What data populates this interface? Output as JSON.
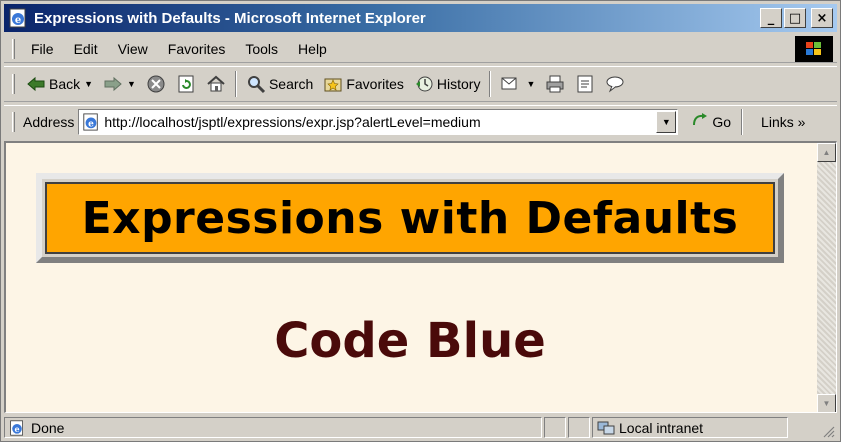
{
  "window": {
    "title": "Expressions with Defaults - Microsoft Internet Explorer",
    "buttons": {
      "minimize": "_",
      "maximize": "□",
      "close": "×"
    }
  },
  "menu": {
    "items": [
      "File",
      "Edit",
      "View",
      "Favorites",
      "Tools",
      "Help"
    ]
  },
  "toolbar": {
    "back_label": "Back",
    "search_label": "Search",
    "favorites_label": "Favorites",
    "history_label": "History"
  },
  "address": {
    "label": "Address",
    "url": "http://localhost/jsptl/expressions/expr.jsp?alertLevel=medium",
    "go_label": "Go",
    "links_label": "Links »"
  },
  "page": {
    "heading": "Expressions with Defaults",
    "message": "Code Blue",
    "background": "#fdf5e6",
    "heading_bg": "#ffa500",
    "message_color": "#4a0a0a"
  },
  "status": {
    "text": "Done",
    "zone": "Local intranet"
  },
  "icons": [
    "ie-page-icon",
    "windows-logo-icon",
    "back-arrow-icon",
    "forward-arrow-icon",
    "stop-icon",
    "refresh-icon",
    "home-icon",
    "search-icon",
    "favorites-icon",
    "history-icon",
    "mail-icon",
    "print-icon",
    "edit-icon",
    "discuss-icon",
    "go-icon",
    "local-intranet-icon"
  ]
}
